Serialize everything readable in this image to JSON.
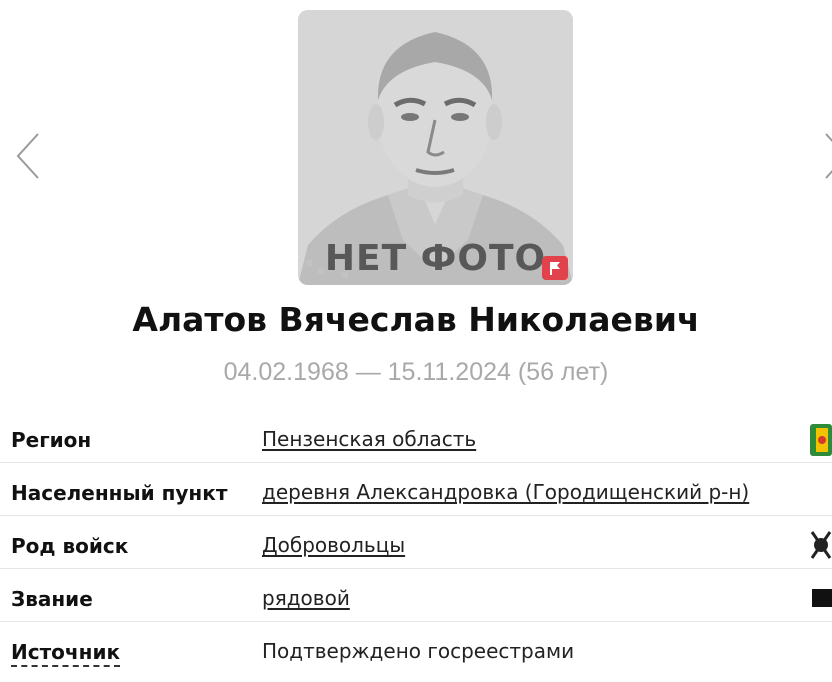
{
  "photo": {
    "placeholder_text": "НЕТ ФОТО"
  },
  "person": {
    "name": "Алатов Вячеслав Николаевич",
    "dates": "04.02.1968 — 15.11.2024 (56 лет)"
  },
  "info": {
    "region_label": "Регион",
    "region_value": "Пензенская область",
    "locality_label": "Населенный пункт",
    "locality_value": "деревня Александровка (Городищенский р-н)",
    "troops_label": "Род войск",
    "troops_value": "Добровольцы",
    "rank_label": "Звание",
    "rank_value": "рядовой",
    "source_label": "Источник",
    "source_value": "Подтверждено госреестрами"
  },
  "colors": {
    "accent_flag": "#e2424b",
    "muted_text": "#a9a9a9"
  },
  "icons": {
    "prev": "chevron-left-icon",
    "next": "chevron-right-icon",
    "report": "flag-icon",
    "region": "region-flag-icon",
    "troops": "troops-emblem-icon",
    "rank": "rank-insignia-icon"
  }
}
